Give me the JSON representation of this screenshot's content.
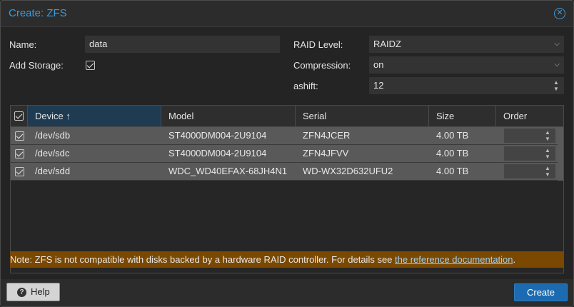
{
  "window": {
    "title": "Create: ZFS"
  },
  "form": {
    "name_label": "Name:",
    "name_value": "data",
    "add_storage_label": "Add Storage:",
    "add_storage_checked": true,
    "raid_level_label": "RAID Level:",
    "raid_level_value": "RAIDZ",
    "compression_label": "Compression:",
    "compression_value": "on",
    "ashift_label": "ashift:",
    "ashift_value": "12"
  },
  "grid": {
    "columns": {
      "device": "Device ↑",
      "model": "Model",
      "serial": "Serial",
      "size": "Size",
      "order": "Order"
    },
    "rows": [
      {
        "device": "/dev/sdb",
        "model": "ST4000DM004-2U9104",
        "serial": "ZFN4JCER",
        "size": "4.00 TB",
        "checked": true
      },
      {
        "device": "/dev/sdc",
        "model": "ST4000DM004-2U9104",
        "serial": "ZFN4JFVV",
        "size": "4.00 TB",
        "checked": true
      },
      {
        "device": "/dev/sdd",
        "model": "WDC_WD40EFAX-68JH4N1",
        "serial": "WD-WX32D632UFU2",
        "size": "4.00 TB",
        "checked": true
      }
    ]
  },
  "note": {
    "text": "Note: ZFS is not compatible with disks backed by a hardware RAID controller. For details see ",
    "link": "the reference documentation",
    "suffix": "."
  },
  "footer": {
    "help_label": "Help",
    "create_label": "Create"
  },
  "colors": {
    "accent": "#3f9ad6",
    "note_bg": "#7a4800",
    "primary_button": "#1c6bb0"
  }
}
